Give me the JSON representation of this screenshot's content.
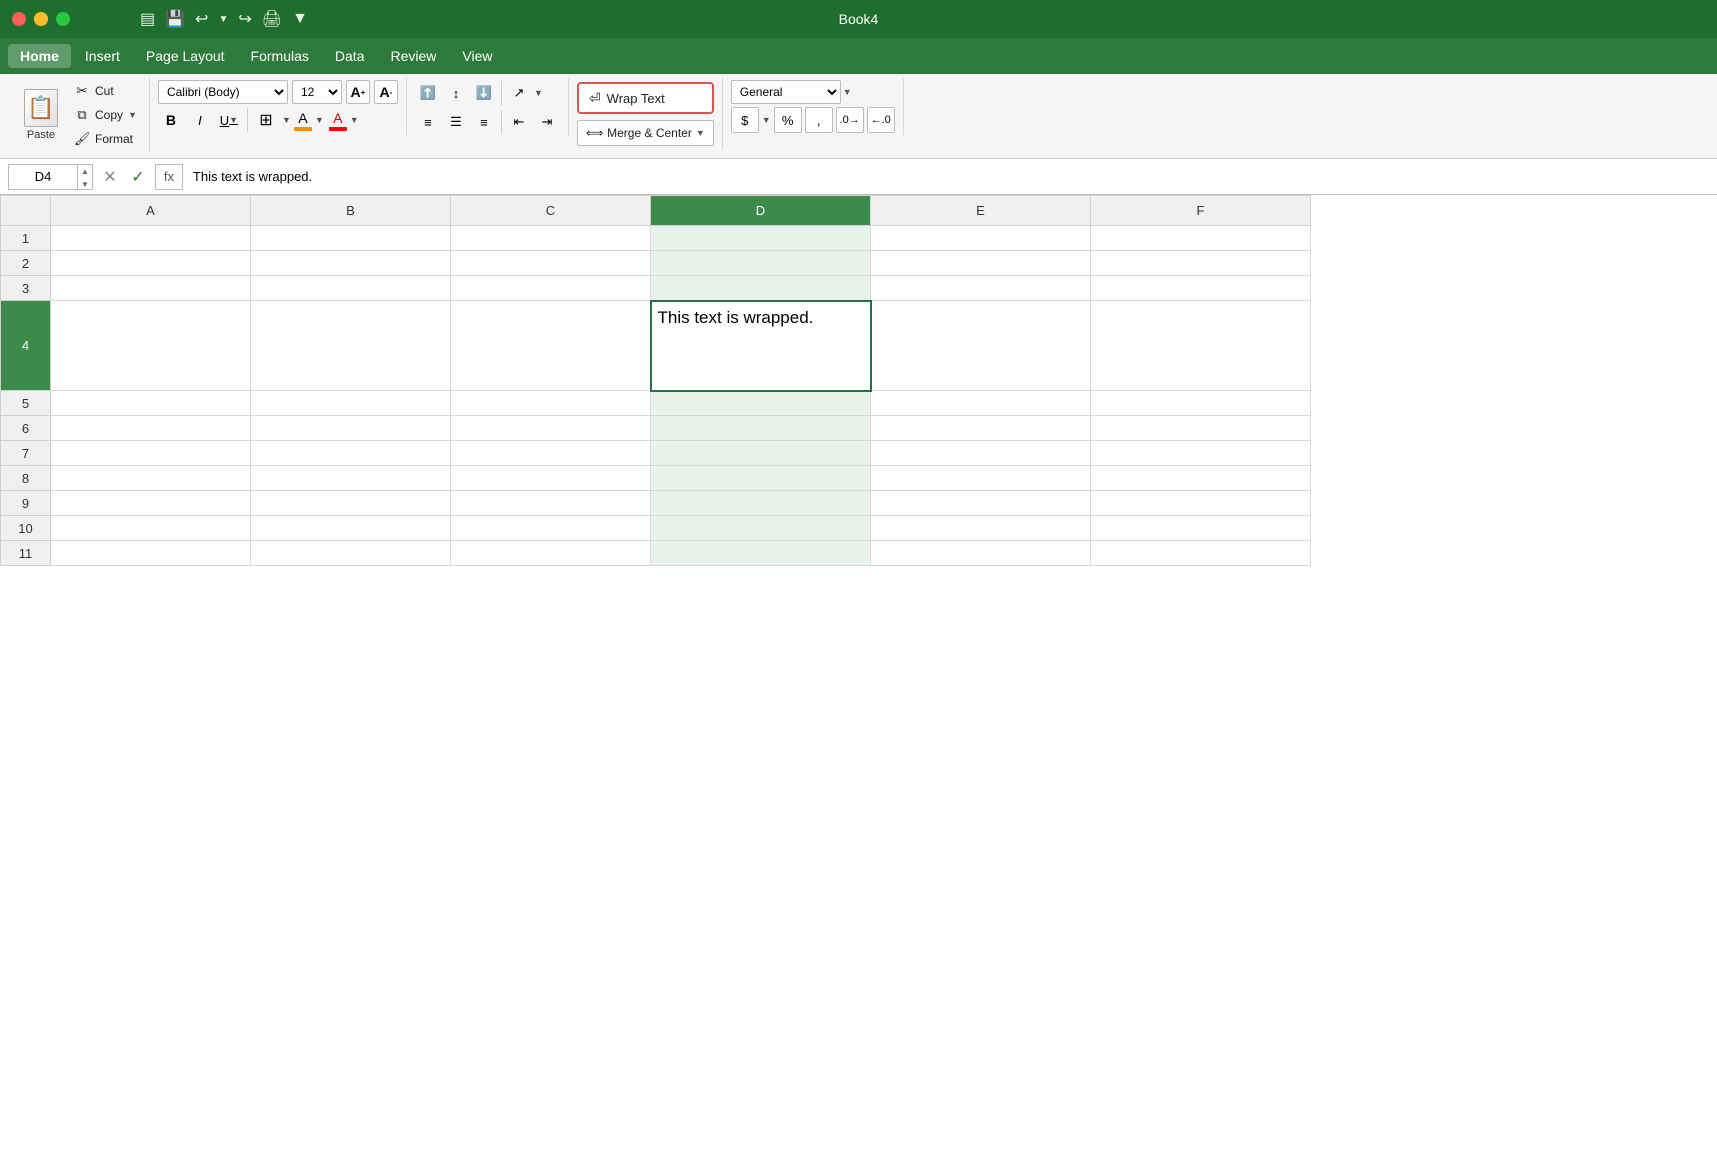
{
  "window": {
    "title": "Book4",
    "traffic_lights": [
      "close",
      "minimize",
      "maximize"
    ]
  },
  "menu": {
    "items": [
      "Home",
      "Insert",
      "Page Layout",
      "Formulas",
      "Data",
      "Review",
      "View"
    ],
    "active": "Home"
  },
  "ribbon": {
    "clipboard": {
      "paste_label": "Paste",
      "cut_label": "Cut",
      "copy_label": "Copy",
      "format_label": "Format"
    },
    "font": {
      "name": "Calibri (Body)",
      "size": "12",
      "bold": "B",
      "italic": "I",
      "underline": "U",
      "fill_color": "#FF8C00",
      "font_color": "#FF0000"
    },
    "alignment": {
      "wrap_text_label": "Wrap Text",
      "merge_label": "Merge & Center"
    },
    "number": {
      "format": "General"
    }
  },
  "formula_bar": {
    "cell_ref": "D4",
    "formula": "This text is wrapped.",
    "fx_label": "fx"
  },
  "columns": [
    "A",
    "B",
    "C",
    "D",
    "E",
    "F"
  ],
  "rows": [
    "1",
    "2",
    "3",
    "4",
    "5",
    "6",
    "7",
    "8",
    "9",
    "10",
    "11"
  ],
  "cells": {
    "D4": "This text is wrapped."
  }
}
